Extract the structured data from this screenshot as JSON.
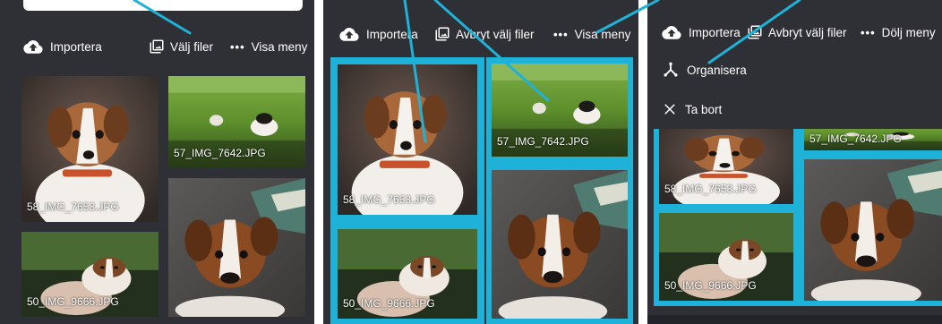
{
  "panel1": {
    "toolbar": {
      "import": "Importera",
      "select": "Välj filer",
      "menu": "Visa meny"
    },
    "photos": [
      "58_IMG_7653.JPG",
      "57_IMG_7642.JPG",
      "50_IMG_9666.JPG"
    ]
  },
  "panel2": {
    "toolbar": {
      "import": "Importera",
      "select": "Avbryt välj filer",
      "menu": "Visa meny"
    },
    "photos": [
      "58_IMG_7653.JPG",
      "57_IMG_7642.JPG",
      "50_IMG_9666.JPG"
    ]
  },
  "panel3": {
    "toolbar": {
      "import": "Importera",
      "select": "Avbryt välj filer",
      "menu": "Dölj meny"
    },
    "menu": {
      "organize": "Organisera",
      "delete": "Ta bort"
    },
    "photos": [
      "58_IMG_7653.JPG",
      "57_IMG_7642.JPG",
      "50_IMG_9666.JPG"
    ]
  },
  "colors": {
    "accent": "#1fb2d8",
    "background": "#2f2f36"
  }
}
